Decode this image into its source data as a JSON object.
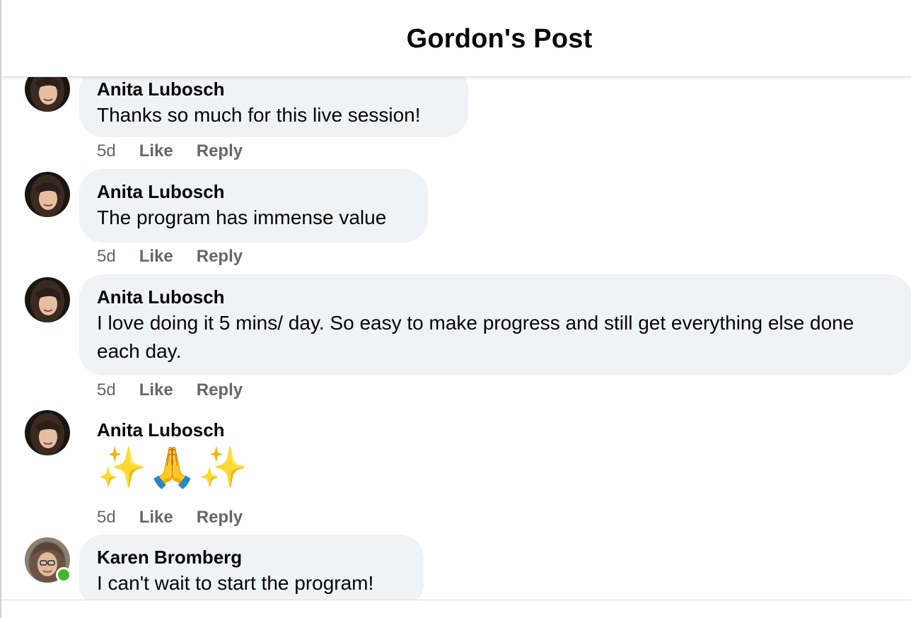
{
  "header": {
    "title": "Gordon's Post"
  },
  "comments": [
    {
      "author": "Anita Lubosch",
      "text": "Thanks so much for this live session!",
      "time": "5d",
      "like": "Like",
      "reply": "Reply"
    },
    {
      "author": "Anita Lubosch",
      "text": "The program has immense value",
      "time": "5d",
      "like": "Like",
      "reply": "Reply"
    },
    {
      "author": "Anita Lubosch",
      "text": "I love doing it 5 mins/ day. So easy to make progress and still get everything else done each day.",
      "time": "5d",
      "like": "Like",
      "reply": "Reply"
    },
    {
      "author": "Anita Lubosch",
      "text": "✨🙏✨",
      "time": "5d",
      "like": "Like",
      "reply": "Reply"
    },
    {
      "author": "Karen Bromberg",
      "text": "I can't wait to start the program!",
      "online": true
    }
  ],
  "colors": {
    "bubble": "#f0f2f5",
    "secondary_text": "#65676b",
    "online": "#42b72a"
  }
}
